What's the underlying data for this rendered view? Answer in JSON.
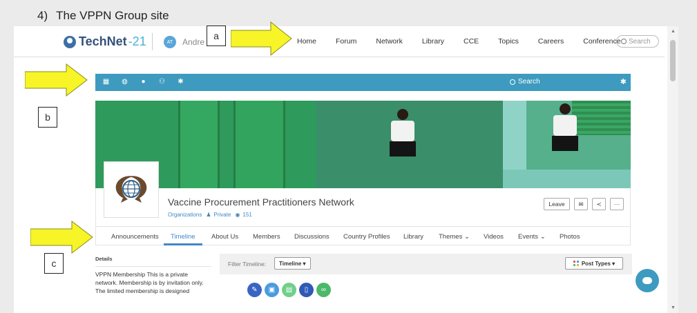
{
  "heading": {
    "number": "4)",
    "title": "The VPPN Group site"
  },
  "site": {
    "logo_main": "TechNet",
    "logo_accent": "-21",
    "user_initials": "AT",
    "user_name": "Andre",
    "nav": [
      "Home",
      "Forum",
      "Network",
      "Library",
      "CCE",
      "Topics",
      "Careers",
      "Conference"
    ],
    "search_placeholder": "Search"
  },
  "toolbar": {
    "icons": [
      "apps-grid-icon",
      "globe-icon",
      "chat-icon",
      "users-icon",
      "gear-icon"
    ],
    "search_label": "Search"
  },
  "group": {
    "name": "Vaccine Procurement Practitioners Network",
    "category": "Organizations",
    "privacy": "Private",
    "views": "151",
    "actions": {
      "leave": "Leave"
    }
  },
  "tabs": [
    "Announcements",
    "Timeline",
    "About Us",
    "Members",
    "Discussions",
    "Country Profiles",
    "Library",
    "Themes",
    "Videos",
    "Events",
    "Photos"
  ],
  "active_tab": "Timeline",
  "details": {
    "heading": "Details",
    "text": "VPPN Membership This is a private network. Membership is by invitation only. The limited membership is designed"
  },
  "timeline": {
    "filter_label": "Filter Timeline:",
    "filter_value": "Timeline",
    "post_types_label": "Post Types"
  },
  "post_icon_colors": [
    "#3a64c4",
    "#4a9be0",
    "#6fd08a",
    "#2f5ab5",
    "#4cb86a"
  ],
  "callouts": [
    "a",
    "b",
    "c"
  ],
  "colors": {
    "toolbar": "#3e9bbf",
    "link": "#3d87c8",
    "arrow": "#f7f427"
  }
}
